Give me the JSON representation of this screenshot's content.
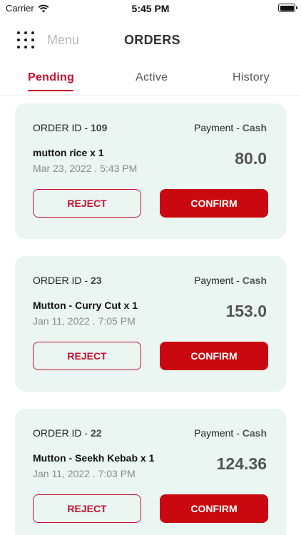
{
  "status_bar": {
    "carrier": "Carrier",
    "time": "5:45 PM"
  },
  "header": {
    "menu_label": "Menu",
    "title": "ORDERS"
  },
  "tabs": [
    {
      "label": "Pending",
      "active": true
    },
    {
      "label": "Active",
      "active": false
    },
    {
      "label": "History",
      "active": false
    }
  ],
  "order_id_label": "ORDER ID -",
  "payment_label": "Payment -",
  "reject_label": "REJECT",
  "confirm_label": "CONFIRM",
  "orders": [
    {
      "id": "109",
      "payment_method": "Cash",
      "item": "mutton rice x 1",
      "date": "Mar 23, 2022 . 5:43 PM",
      "amount": "80.0"
    },
    {
      "id": "23",
      "payment_method": "Cash",
      "item": "Mutton - Curry Cut x 1",
      "date": "Jan 11, 2022 . 7:05 PM",
      "amount": "153.0"
    },
    {
      "id": "22",
      "payment_method": "Cash",
      "item": "Mutton - Seekh Kebab x 1",
      "date": "Jan 11, 2022 . 7:03 PM",
      "amount": "124.36"
    }
  ],
  "colors": {
    "accent": "#c8102e",
    "card_bg": "#ebf5f2",
    "confirm_bg": "#c9090f"
  }
}
